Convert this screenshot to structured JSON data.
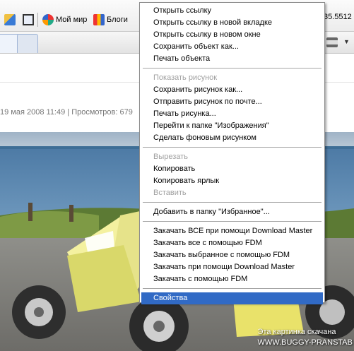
{
  "toolbar": {
    "moi_mir_label": "Мой мир",
    "blogi_label": "Блоги",
    "number_fragment": "35.5512"
  },
  "page": {
    "meta_text": "19 мая 2008 11:49 | Просмотров: 679"
  },
  "photo": {
    "caption_line1": "Эта картинка скачана",
    "caption_line2": "WWW.BUGGY-PRANSTAB"
  },
  "context_menu": {
    "group1": [
      "Открыть ссылку",
      "Открыть ссылку в новой вкладке",
      "Открыть ссылку в новом окне",
      "Сохранить объект как...",
      "Печать объекта"
    ],
    "group2": [
      "Показать рисунок",
      "Сохранить рисунок как...",
      "Отправить рисунок по почте...",
      "Печать рисунка...",
      "Перейти к папке \"Изображения\"",
      "Сделать фоновым рисунком"
    ],
    "group3": [
      "Вырезать",
      "Копировать",
      "Копировать ярлык",
      "Вставить"
    ],
    "group4": [
      "Добавить в папку \"Избранное\"..."
    ],
    "group5": [
      "Закачать ВСЕ при помощи Download Master",
      "Закачать все с помощью FDM",
      "Закачать выбранное с помощью FDM",
      "Закачать при помощи Download Master",
      "Закачать с помощью FDM"
    ],
    "group6": [
      "Свойства"
    ]
  }
}
